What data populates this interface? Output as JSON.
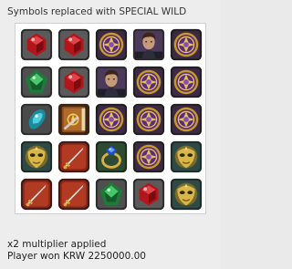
{
  "header": {
    "text": "Symbols replaced with SPECIAL WILD"
  },
  "board": {
    "rows": [
      [
        "red-gem",
        "red-gem",
        "wild-medallion",
        "hero-portrait",
        "wild-medallion"
      ],
      [
        "green-gem",
        "red-gem",
        "hero-portrait",
        "wild-medallion",
        "wild-medallion"
      ],
      [
        "teal-gem",
        "spellbook",
        "wild-medallion",
        "wild-medallion",
        "wild-medallion"
      ],
      [
        "golden-mask",
        "sword-emblem",
        "sapphire-ring",
        "wild-medallion",
        "golden-mask"
      ],
      [
        "sword-emblem",
        "sword-emblem",
        "green-gem",
        "red-gem",
        "golden-mask"
      ]
    ]
  },
  "footer": {
    "line1": "x2 multiplier applied",
    "line2": "Player won KRW 2250000.00"
  }
}
